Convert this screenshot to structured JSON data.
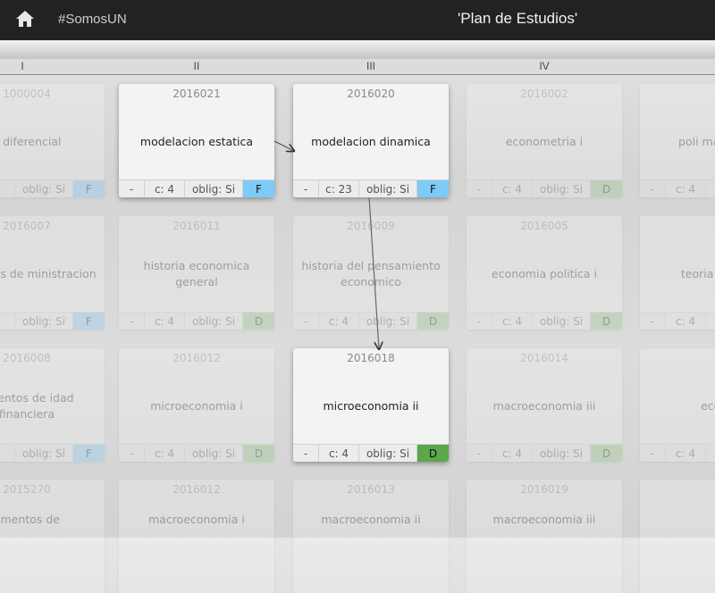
{
  "header": {
    "tag": "#SomosUN",
    "title": "'Plan de Estudios'"
  },
  "levels": [
    "I",
    "II",
    "III",
    "IV"
  ],
  "footer_dash": "-",
  "cards": {
    "r0c0": {
      "code": "1000004",
      "name": "o diferencial",
      "credits": "",
      "oblig": "oblig: Si",
      "tag": "F"
    },
    "modelacion_estatica": {
      "code": "2016021",
      "name": "modelacion estatica",
      "credits": "c: 4",
      "oblig": "oblig: Si",
      "tag": "F"
    },
    "modelacion_dinamica": {
      "code": "2016020",
      "name": "modelacion dinamica",
      "credits": "c: 23",
      "oblig": "oblig: Si",
      "tag": "F"
    },
    "econometria": {
      "code": "2016002",
      "name": "econometria i",
      "credits": "c: 4",
      "oblig": "oblig: Si",
      "tag": "D"
    },
    "r0c4": {
      "code": "",
      "name": "poli macroeco",
      "credits": "c: 4",
      "oblig": "",
      "tag": ""
    },
    "r1c0": {
      "code": "2016007",
      "name": "amentos de ministracion",
      "credits": "",
      "oblig": "oblig: Si",
      "tag": "F"
    },
    "historia_economica": {
      "code": "2016011",
      "name": "historia economica general",
      "credits": "c: 4",
      "oblig": "oblig: Si",
      "tag": "D"
    },
    "historia_pensamiento": {
      "code": "2016009",
      "name": "historia del pensamiento economico",
      "credits": "c: 4",
      "oblig": "oblig: Si",
      "tag": "D"
    },
    "economia_politica": {
      "code": "2016005",
      "name": "economia politica i",
      "credits": "c: 4",
      "oblig": "oblig: Si",
      "tag": "D"
    },
    "r1c4": {
      "code": "",
      "name": "teoria mo firr",
      "credits": "c: 4",
      "oblig": "",
      "tag": ""
    },
    "r2c0": {
      "code": "2016008",
      "name": "amentos de idad financiera",
      "credits": "",
      "oblig": "oblig: Si",
      "tag": "F"
    },
    "microeconomia_i": {
      "code": "2016012",
      "name": "microeconomia i",
      "credits": "c: 4",
      "oblig": "oblig: Si",
      "tag": "D"
    },
    "microeconomia_ii": {
      "code": "2016018",
      "name": "microeconomia ii",
      "credits": "c: 4",
      "oblig": "oblig: Si",
      "tag": "D"
    },
    "macroeconomia_iii": {
      "code": "2016014",
      "name": "macroeconomia iii",
      "credits": "c: 4",
      "oblig": "oblig: Si",
      "tag": "D"
    },
    "r2c4": {
      "code": "",
      "name": "econo",
      "credits": "c: 4",
      "oblig": "",
      "tag": ""
    },
    "r3c0": {
      "code": "2015270",
      "name": "amentos de",
      "credits": "",
      "oblig": "",
      "tag": ""
    },
    "r3c1": {
      "code": "2016012",
      "name": "macroeconomia i",
      "credits": "",
      "oblig": "",
      "tag": ""
    },
    "r3c2": {
      "code": "2016013",
      "name": "macroeconomia ii",
      "credits": "",
      "oblig": "",
      "tag": ""
    },
    "r3c3": {
      "code": "2016019",
      "name": "macroeconomia iii",
      "credits": "",
      "oblig": "",
      "tag": ""
    }
  },
  "colors": {
    "topbar": "#222222",
    "tag_F": "#7ecaf8",
    "tag_D": "#5aa84a"
  }
}
